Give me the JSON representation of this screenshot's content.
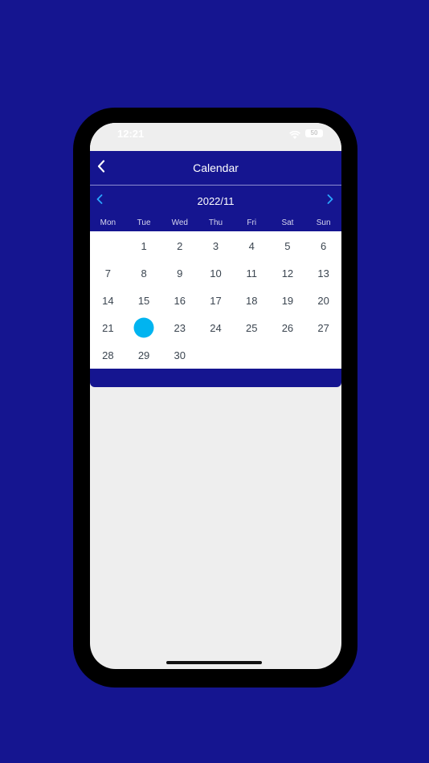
{
  "status_bar": {
    "time": "12:21",
    "battery": "50"
  },
  "header": {
    "title": "Calendar"
  },
  "calendar": {
    "month_label": "2022/11",
    "weekdays": [
      "Mon",
      "Tue",
      "Wed",
      "Thu",
      "Fri",
      "Sat",
      "Sun"
    ],
    "days": [
      "",
      "1",
      "2",
      "3",
      "4",
      "5",
      "6",
      "7",
      "8",
      "9",
      "10",
      "11",
      "12",
      "13",
      "14",
      "15",
      "16",
      "17",
      "18",
      "19",
      "20",
      "21",
      "22",
      "23",
      "24",
      "25",
      "26",
      "27",
      "28",
      "29",
      "30",
      "",
      "",
      "",
      ""
    ],
    "selected_day": "22"
  },
  "colors": {
    "brand": "#151590",
    "accent": "#00b4f0",
    "surface": "#eeeeee"
  }
}
